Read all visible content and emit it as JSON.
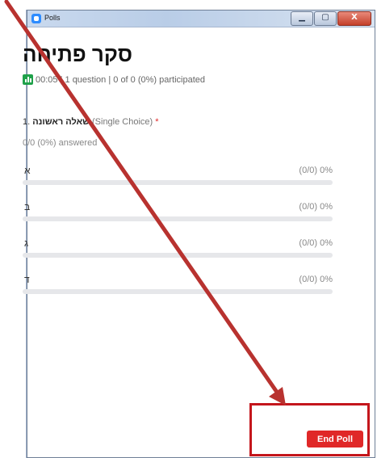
{
  "window": {
    "title": "Polls",
    "controls": {
      "minimize": "▁",
      "maximize": "▢",
      "close": "X"
    }
  },
  "poll": {
    "title": "סקר פתיחה",
    "elapsed": "00:05",
    "question_count": "1 question",
    "participation": "0 of 0 (0%) participated"
  },
  "question": {
    "number": "1.",
    "text": "שאלה ראשונה",
    "type": "(Single Choice)",
    "required_mark": "*",
    "answered": "0/0 (0%) answered",
    "options": [
      {
        "label": "א",
        "result": "(0/0) 0%",
        "fraction": 0
      },
      {
        "label": "ב",
        "result": "(0/0) 0%",
        "fraction": 0
      },
      {
        "label": "ג",
        "result": "(0/0) 0%",
        "fraction": 0
      },
      {
        "label": "ד",
        "result": "(0/0) 0%",
        "fraction": 0
      }
    ]
  },
  "footer": {
    "end_poll_label": "End Poll"
  },
  "colors": {
    "accent": "#2d8cff",
    "danger": "#e02828",
    "annotation": "#b8322f"
  }
}
